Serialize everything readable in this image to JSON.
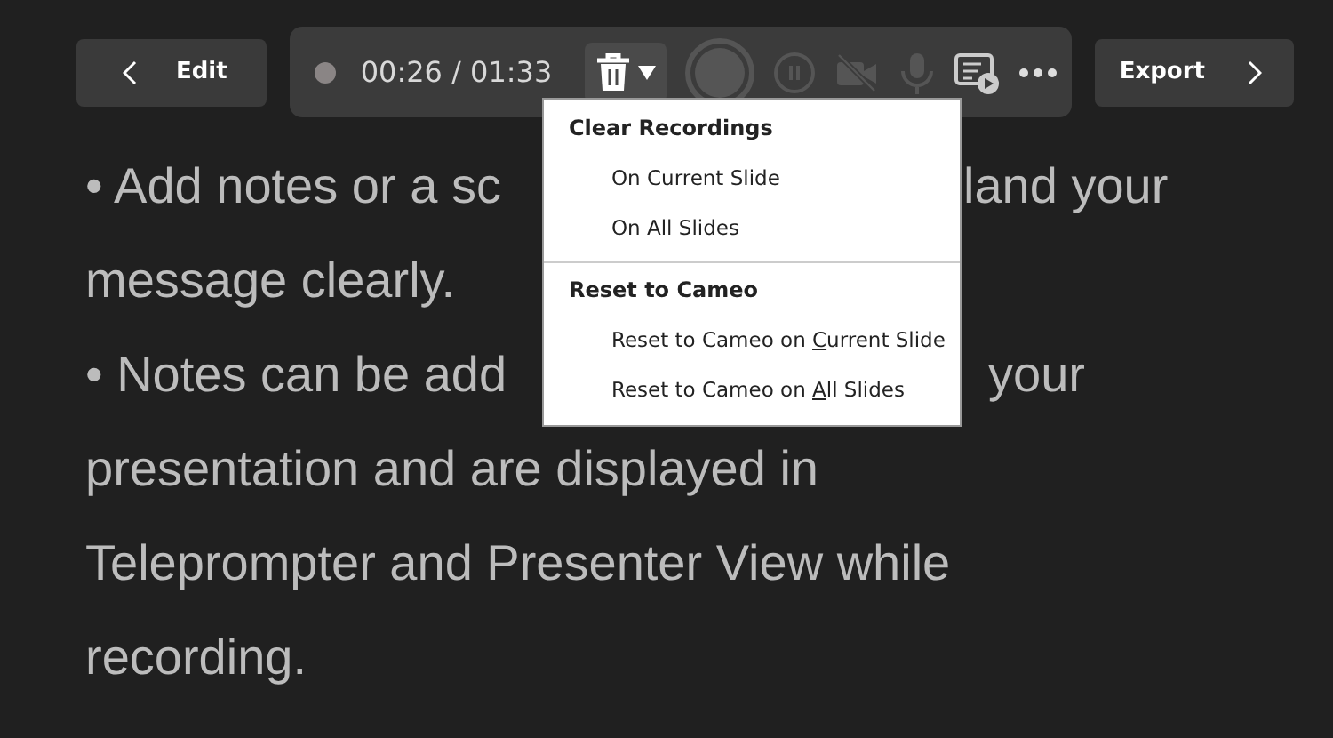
{
  "toolbar": {
    "back_button": "Edit",
    "timer": "00:26 / 01:33",
    "export_button": "Export"
  },
  "menu": {
    "sections": [
      {
        "heading": "Clear Recordings",
        "items": [
          {
            "label_start": "On Current Slide"
          },
          {
            "label_start": "On All Slides"
          }
        ]
      },
      {
        "heading": "Reset to Cameo",
        "items": [
          {
            "label_start": "Reset to Cameo on ",
            "access_key": "C",
            "label_end": "urrent Slide"
          },
          {
            "label_start": "Reset to Cameo on ",
            "access_key": "A",
            "label_end": "ll Slides"
          }
        ]
      }
    ]
  },
  "notes": {
    "lines": [
      {
        "left": "• Add notes or a sc",
        "right": "land your"
      },
      {
        "left": "message clearly."
      },
      {
        "left": "• Notes can be add",
        "right": "your"
      },
      {
        "left": "presentation and are displayed in"
      },
      {
        "left": "Teleprompter and Presenter View while"
      },
      {
        "left": "recording."
      }
    ]
  }
}
